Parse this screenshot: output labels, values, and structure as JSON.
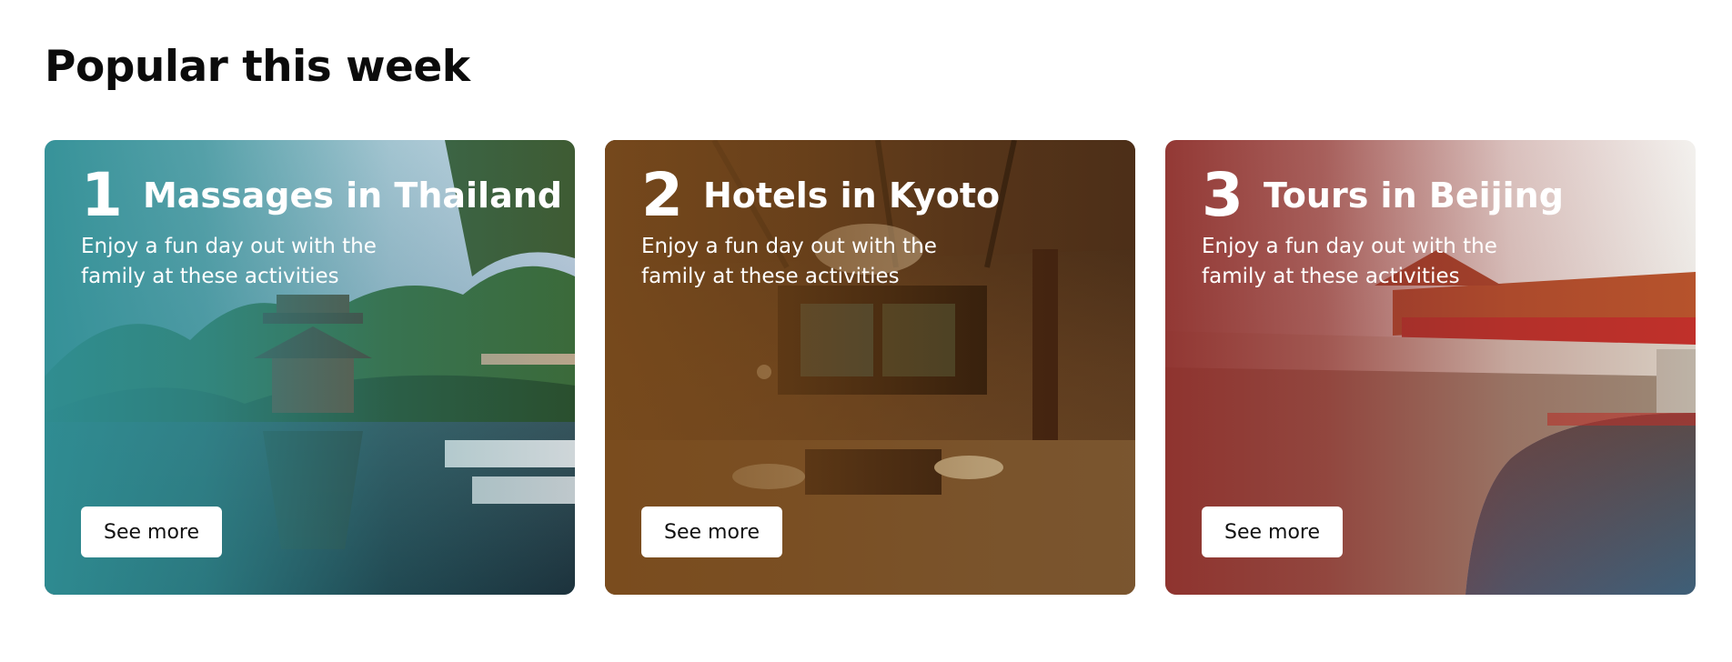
{
  "section": {
    "title": "Popular this week"
  },
  "cards": [
    {
      "number": "1",
      "title": "Massages in Thailand",
      "description": "Enjoy a fun day out with the family at these activities",
      "button_label": "See more",
      "accent_color": "#2f8f95"
    },
    {
      "number": "2",
      "title": "Hotels in Kyoto",
      "description": "Enjoy a fun day out with the family at these activities",
      "button_label": "See more",
      "accent_color": "#7a4b1c"
    },
    {
      "number": "3",
      "title": "Tours in Beijing",
      "description": "Enjoy a fun day out with the family at these activities",
      "button_label": "See more",
      "accent_color": "#8e2f2b"
    }
  ]
}
